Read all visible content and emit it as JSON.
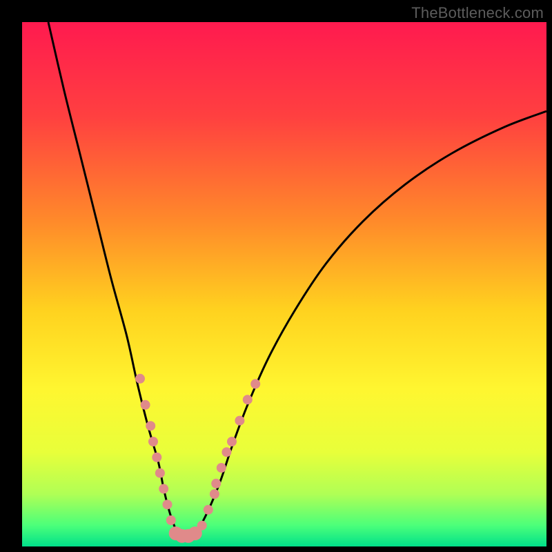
{
  "watermark": "TheBottleneck.com",
  "gradient": {
    "stops": [
      {
        "offset": 0.0,
        "color": "#ff1a4f"
      },
      {
        "offset": 0.18,
        "color": "#ff4040"
      },
      {
        "offset": 0.38,
        "color": "#ff8a2a"
      },
      {
        "offset": 0.55,
        "color": "#ffd21f"
      },
      {
        "offset": 0.7,
        "color": "#fff630"
      },
      {
        "offset": 0.82,
        "color": "#e8ff3a"
      },
      {
        "offset": 0.9,
        "color": "#b0ff55"
      },
      {
        "offset": 0.96,
        "color": "#4bff7a"
      },
      {
        "offset": 1.0,
        "color": "#00e08a"
      }
    ]
  },
  "chart_data": {
    "type": "line",
    "title": "",
    "xlabel": "",
    "ylabel": "",
    "xlim": [
      0,
      100
    ],
    "ylim": [
      0,
      100
    ],
    "series": [
      {
        "name": "curve",
        "x": [
          5,
          8,
          11,
          14,
          17,
          20,
          22,
          24,
          26,
          27,
          28,
          29,
          30,
          32,
          34,
          36,
          38,
          40,
          43,
          47,
          52,
          58,
          65,
          73,
          82,
          92,
          100
        ],
        "y": [
          100,
          87,
          75,
          63,
          51,
          40,
          31,
          23,
          16,
          11,
          7,
          4,
          2,
          2,
          4,
          8,
          13,
          19,
          27,
          36,
          45,
          54,
          62,
          69,
          75,
          80,
          83
        ]
      }
    ],
    "dot_series": {
      "name": "markers",
      "color": "#e08a8a",
      "radius_small": 7,
      "radius_large": 10,
      "points": [
        {
          "x": 22.5,
          "y": 32,
          "r": "small"
        },
        {
          "x": 23.5,
          "y": 27,
          "r": "small"
        },
        {
          "x": 24.5,
          "y": 23,
          "r": "small"
        },
        {
          "x": 25.0,
          "y": 20,
          "r": "small"
        },
        {
          "x": 25.7,
          "y": 17,
          "r": "small"
        },
        {
          "x": 26.3,
          "y": 14,
          "r": "small"
        },
        {
          "x": 27.0,
          "y": 11,
          "r": "small"
        },
        {
          "x": 27.7,
          "y": 8,
          "r": "small"
        },
        {
          "x": 28.4,
          "y": 5,
          "r": "small"
        },
        {
          "x": 29.3,
          "y": 2.5,
          "r": "large"
        },
        {
          "x": 30.5,
          "y": 2,
          "r": "large"
        },
        {
          "x": 31.7,
          "y": 2,
          "r": "large"
        },
        {
          "x": 33.0,
          "y": 2.5,
          "r": "large"
        },
        {
          "x": 34.3,
          "y": 4,
          "r": "small"
        },
        {
          "x": 35.5,
          "y": 7,
          "r": "small"
        },
        {
          "x": 36.7,
          "y": 10,
          "r": "small"
        },
        {
          "x": 37.0,
          "y": 12,
          "r": "small"
        },
        {
          "x": 38.0,
          "y": 15,
          "r": "small"
        },
        {
          "x": 39.0,
          "y": 18,
          "r": "small"
        },
        {
          "x": 40.0,
          "y": 20,
          "r": "small"
        },
        {
          "x": 41.5,
          "y": 24,
          "r": "small"
        },
        {
          "x": 43.0,
          "y": 28,
          "r": "small"
        },
        {
          "x": 44.5,
          "y": 31,
          "r": "small"
        }
      ]
    }
  }
}
